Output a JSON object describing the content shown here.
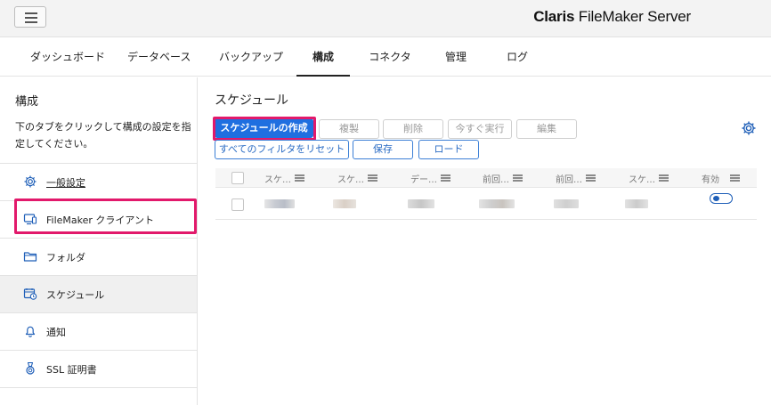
{
  "app": {
    "brand_bold": "Claris",
    "brand_rest": " FileMaker Server"
  },
  "nav": {
    "tabs": [
      {
        "label": "ダッシュボード"
      },
      {
        "label": "データベース"
      },
      {
        "label": "バックアップ"
      },
      {
        "label": "構成",
        "active": true
      },
      {
        "label": "コネクタ"
      },
      {
        "label": "管理"
      },
      {
        "label": "ログ"
      }
    ]
  },
  "sidebar": {
    "title": "構成",
    "description": "下のタブをクリックして構成の設定を指定してください。",
    "items": [
      {
        "label": "一般設定",
        "icon": "gear-icon"
      },
      {
        "label": "FileMaker クライアント",
        "icon": "monitor-icon"
      },
      {
        "label": "フォルダ",
        "icon": "folder-icon"
      },
      {
        "label": "スケジュール",
        "icon": "calendar-clock-icon",
        "selected": true
      },
      {
        "label": "通知",
        "icon": "bell-icon"
      },
      {
        "label": "SSL 証明書",
        "icon": "certificate-icon"
      }
    ]
  },
  "main": {
    "title": "スケジュール",
    "buttons": {
      "create": "スケジュールの作成",
      "duplicate": "複製",
      "delete": "削除",
      "run_now": "今すぐ実行",
      "edit": "編集",
      "reset_filters": "すべてのフィルタをリセット",
      "save": "保存",
      "load": "ロード"
    },
    "table": {
      "columns": [
        "スケ…",
        "スケ…",
        "デー…",
        "前回…",
        "前回…",
        "スケ…",
        "有効"
      ]
    }
  },
  "colors": {
    "accent": "#1f6fe0",
    "highlight": "#e2196b"
  }
}
